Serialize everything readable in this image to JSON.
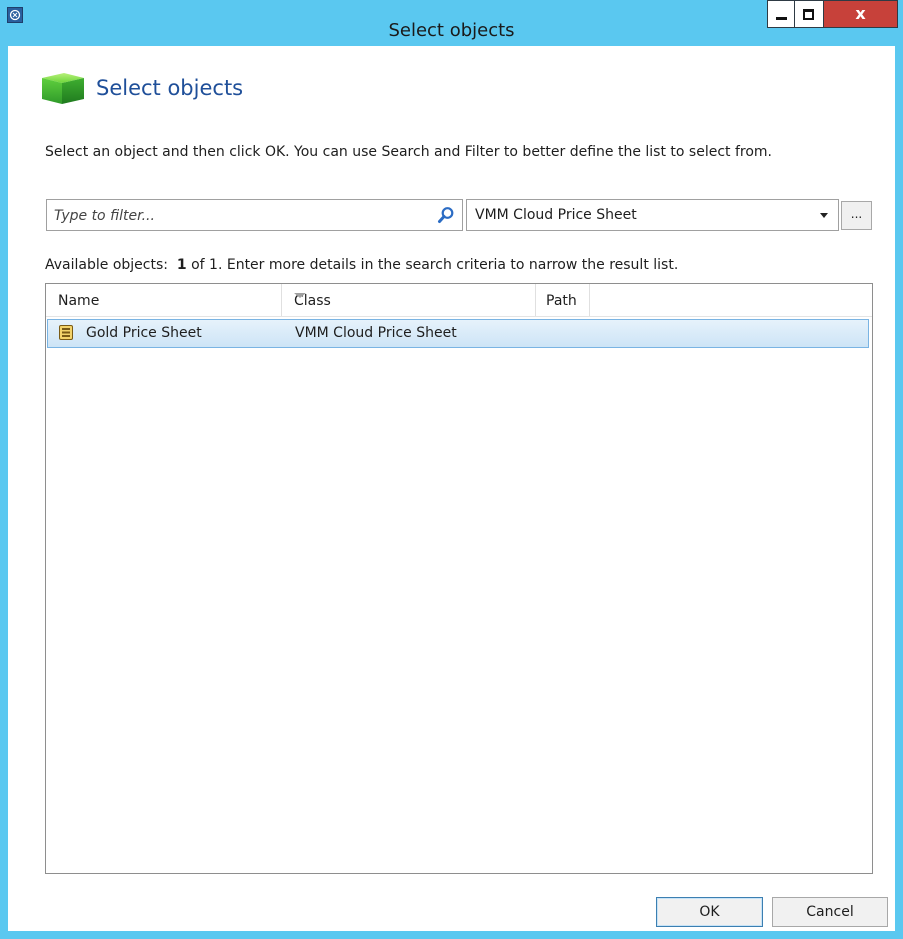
{
  "window": {
    "title": "Select objects"
  },
  "header": {
    "title": "Select objects"
  },
  "instructions": "Select an object and then click OK. You can use Search and Filter to better define the list to select from.",
  "filter": {
    "placeholder": "Type to filter..."
  },
  "class_select": {
    "selected": "VMM Cloud Price Sheet"
  },
  "browse_button": {
    "label": "..."
  },
  "available": {
    "prefix": "Available objects:",
    "count": "1",
    "suffix": "of 1. Enter more details in the search criteria to narrow the result list."
  },
  "list": {
    "columns": [
      "Name",
      "Class",
      "Path"
    ],
    "rows": [
      {
        "name": "Gold Price Sheet",
        "class": "VMM Cloud Price Sheet",
        "path": ""
      }
    ]
  },
  "footer": {
    "ok_label": "OK",
    "cancel_label": "Cancel"
  },
  "colors": {
    "titlebar": "#5ac8f0",
    "close_button": "#c7413a",
    "header_title": "#1f4f99",
    "selected_row": "#cde4f6"
  },
  "icons": [
    "app-icon",
    "cube-icon",
    "search-icon",
    "chevron-down-icon",
    "sort-indicator",
    "price-sheet-icon"
  ]
}
